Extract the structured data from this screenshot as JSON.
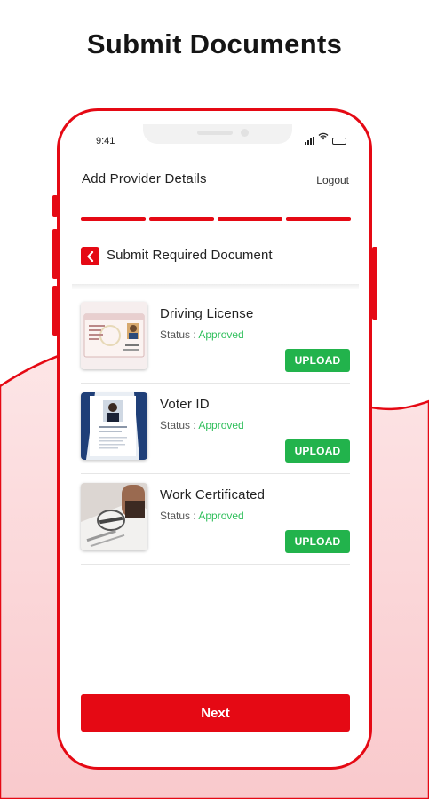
{
  "promo": {
    "title": "Submit Documents"
  },
  "status_bar": {
    "time": "9:41"
  },
  "header": {
    "title": "Add Provider Details",
    "logout_label": "Logout"
  },
  "progress": {
    "steps_total": 4,
    "steps_completed": 4
  },
  "section": {
    "title": "Submit Required Document",
    "back_icon": "chevron-left-icon"
  },
  "documents": [
    {
      "name": "Driving License",
      "status_label": "Status :",
      "status_value": "Approved",
      "upload_label": "UPLOAD",
      "thumb_icon": "driving-license-thumbnail"
    },
    {
      "name": "Voter ID",
      "status_label": "Status :",
      "status_value": "Approved",
      "upload_label": "UPLOAD",
      "thumb_icon": "voter-id-thumbnail"
    },
    {
      "name": "Work Certificated",
      "status_label": "Status :",
      "status_value": "Approved",
      "upload_label": "UPLOAD",
      "thumb_icon": "work-certificate-thumbnail"
    }
  ],
  "footer": {
    "next_label": "Next"
  },
  "colors": {
    "accent": "#e50914",
    "approved": "#2fbf5b",
    "upload": "#22b34c",
    "wave": "#fde3e4"
  }
}
